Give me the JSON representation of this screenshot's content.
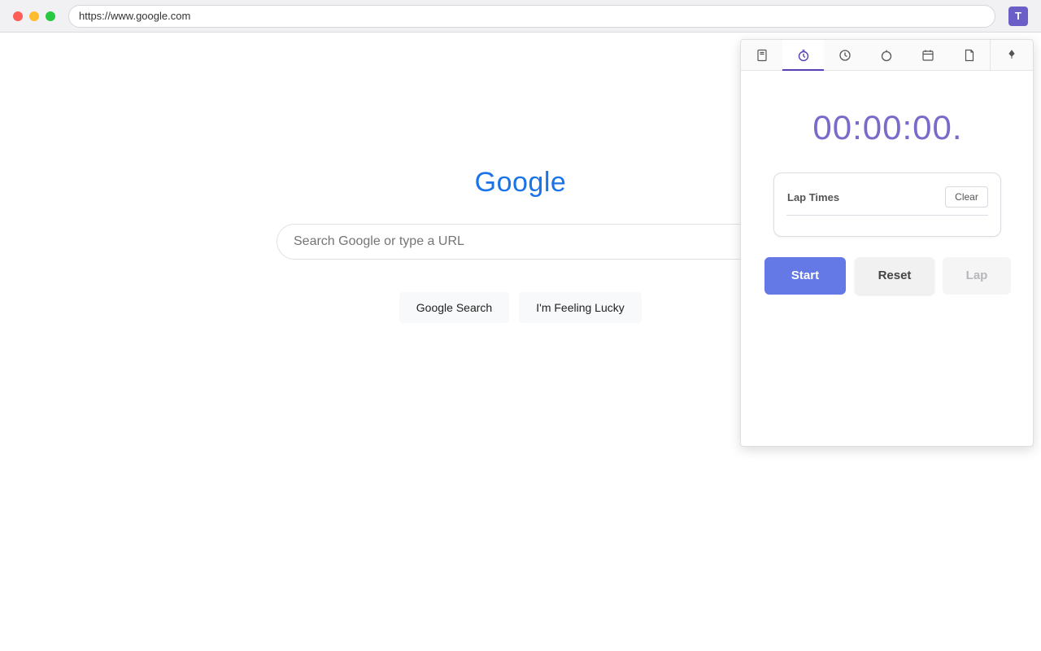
{
  "browser": {
    "url": "https://www.google.com",
    "extension_badge": "T"
  },
  "google": {
    "logo": "Google",
    "search_placeholder": "Search Google or type a URL",
    "search_button": "Google Search",
    "lucky_button": "I'm Feeling Lucky"
  },
  "popup": {
    "tabs": [
      {
        "icon": "notes-icon",
        "active": false
      },
      {
        "icon": "stopwatch-icon",
        "active": true
      },
      {
        "icon": "clock-icon",
        "active": false
      },
      {
        "icon": "timer-icon",
        "active": false
      },
      {
        "icon": "calendar-icon",
        "active": false
      },
      {
        "icon": "document-icon",
        "active": false
      },
      {
        "icon": "pin-icon",
        "active": false
      }
    ],
    "display": "00:00:00.",
    "laps": {
      "title": "Lap Times",
      "clear_label": "Clear"
    },
    "controls": {
      "start": "Start",
      "reset": "Reset",
      "lap": "Lap"
    },
    "colors": {
      "accent": "#5a3fb8",
      "start_button": "#6478e6",
      "display_text": "#7a6ac9"
    }
  }
}
